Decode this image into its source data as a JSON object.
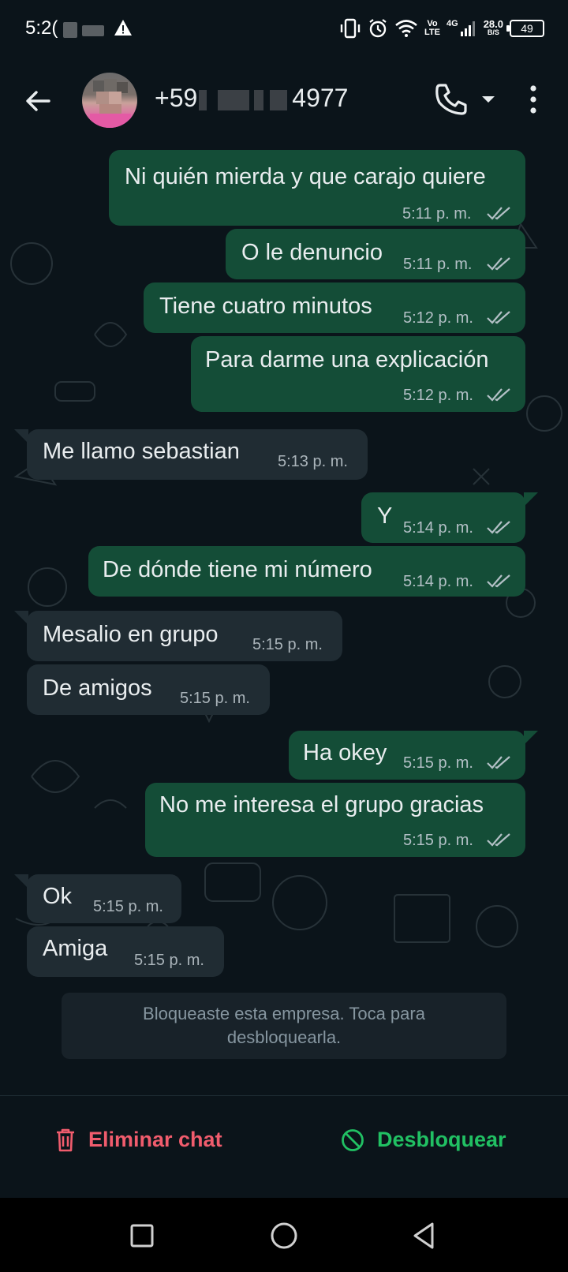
{
  "status_bar": {
    "time": "5:2(",
    "net_speed_value": "28.0",
    "net_speed_unit": "B/S",
    "battery": "49",
    "volte_top": "Vo",
    "volte_bottom": "LTE",
    "network": "4G"
  },
  "header": {
    "contact_prefix": "+59",
    "contact_suffix": "4977"
  },
  "messages": [
    {
      "dir": "out",
      "text": "Ni quién mierda y que carajo quiere",
      "time": "5:11 p. m."
    },
    {
      "dir": "out",
      "text": "O le denuncio",
      "time": "5:11 p. m."
    },
    {
      "dir": "out",
      "text": "Tiene cuatro minutos",
      "time": "5:12 p. m."
    },
    {
      "dir": "out",
      "text": "Para darme una explicación",
      "time": "5:12 p. m."
    },
    {
      "dir": "in",
      "text": "Me llamo sebastian",
      "time": "5:13 p. m."
    },
    {
      "dir": "out",
      "text": "Y",
      "time": "5:14 p. m."
    },
    {
      "dir": "out",
      "text": "De dónde tiene mi número",
      "time": "5:14 p. m."
    },
    {
      "dir": "in",
      "text": "Mesalio en grupo",
      "time": "5:15 p. m."
    },
    {
      "dir": "in",
      "text": "De amigos",
      "time": "5:15 p. m."
    },
    {
      "dir": "out",
      "text": "Ha okey",
      "time": "5:15 p. m."
    },
    {
      "dir": "out",
      "text": "No me interesa el grupo gracias",
      "time": "5:15 p. m."
    },
    {
      "dir": "in",
      "text": "Ok",
      "time": "5:15 p. m."
    },
    {
      "dir": "in",
      "text": "Amiga",
      "time": "5:15 p. m."
    }
  ],
  "blocked_notice": {
    "line1": "Bloqueaste esta empresa. Toca para",
    "line2": "desbloquearla."
  },
  "actions": {
    "delete_label": "Eliminar chat",
    "unblock_label": "Desbloquear"
  },
  "colors": {
    "outgoing_bubble": "#144d37",
    "incoming_bubble": "#202c33",
    "delete_red": "#f15c6d",
    "unblock_green": "#21c063"
  }
}
